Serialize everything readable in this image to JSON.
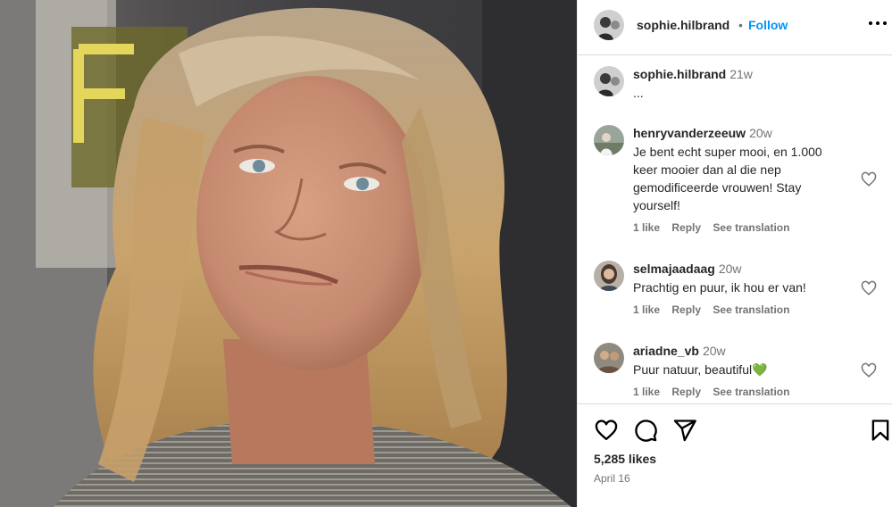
{
  "post": {
    "author": "sophie.hilbrand",
    "separator": "•",
    "follow_label": "Follow",
    "more_icon": "more-options-icon"
  },
  "caption": {
    "username": "sophie.hilbrand",
    "time": "21w",
    "text": "..."
  },
  "comments": [
    {
      "username": "henryvanderzeeuw",
      "time": "20w",
      "text": "Je bent echt super mooi, en 1.000 keer mooier dan al die nep gemodificeerde vrouwen! Stay yourself!",
      "likes": "1 like",
      "reply": "Reply",
      "translate": "See translation"
    },
    {
      "username": "selmajaadaag",
      "time": "20w",
      "text": "Prachtig en puur, ik hou er van!",
      "likes": "1 like",
      "reply": "Reply",
      "translate": "See translation"
    },
    {
      "username": "ariadne_vb",
      "time": "20w",
      "text": "Puur natuur, beautiful💚",
      "likes": "1 like",
      "reply": "Reply",
      "translate": "See translation"
    }
  ],
  "footer": {
    "likes": "5,285 likes",
    "date": "April 16"
  },
  "icons": {
    "like": "heart-icon",
    "comment": "comment-icon",
    "share": "share-icon",
    "save": "bookmark-icon"
  },
  "colors": {
    "accent": "#0095f6",
    "muted": "#737373",
    "divider": "#dbdbdb"
  }
}
